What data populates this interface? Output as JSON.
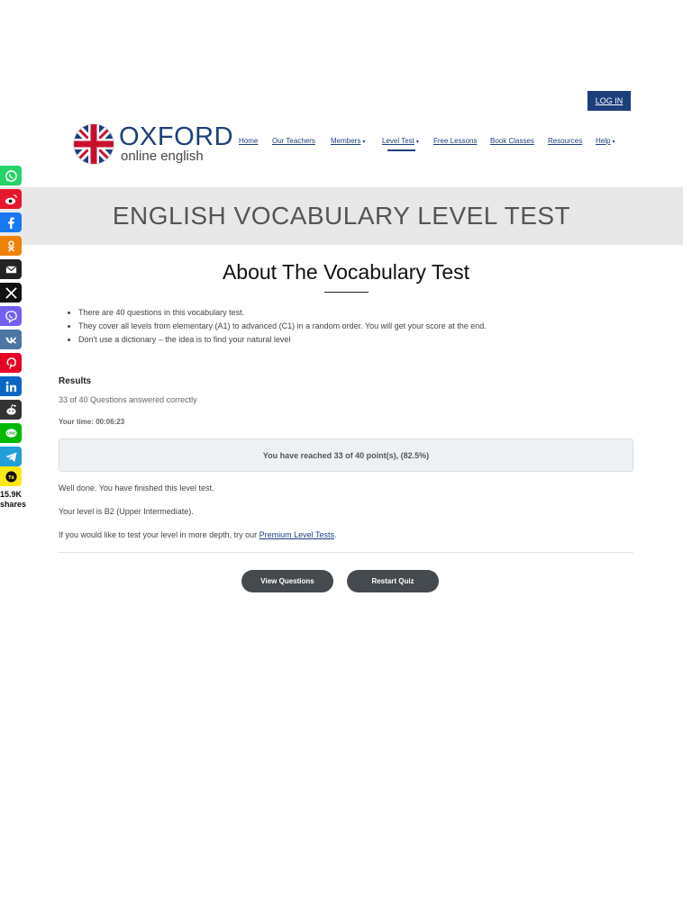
{
  "header": {
    "login_label": "LOG IN",
    "logo": {
      "line1": "OXFORD",
      "line2": "online english"
    },
    "nav": [
      {
        "label": "Home",
        "caret": ""
      },
      {
        "label": "Our Teachers",
        "caret": ""
      },
      {
        "label": "Members",
        "caret": "▾"
      },
      {
        "label": "Level Test",
        "caret": "▾"
      },
      {
        "label": "Free Lessons",
        "caret": ""
      },
      {
        "label": "Book Classes",
        "caret": ""
      },
      {
        "label": "Resources",
        "caret": ""
      },
      {
        "label": "Help",
        "caret": "▾"
      }
    ],
    "active_nav": "Level Test"
  },
  "hero": {
    "title": "ENGLISH VOCABULARY LEVEL TEST"
  },
  "about": {
    "title": "About The Vocabulary Test",
    "bullets": [
      "There are 40 questions in this vocabulary test.",
      "They cover all levels from elementary (A1) to advanced (C1) in a random order. You will get your score at the end.",
      "Don't use a dictionary – the idea is to find your natural level"
    ]
  },
  "results": {
    "label": "Results",
    "count_text": "33 of 40 Questions answered correctly",
    "time_text": "Your time: 00:06:23",
    "score_text": "You have reached 33 of 40 point(s), (82.5%)",
    "done_text": "Well done. You have finished this level test.",
    "level_text": "Your level is B2 (Upper Intermediate).",
    "premium_prefix": "If you would like to test your level in more depth, try our ",
    "premium_link": "Premium Level Tests",
    "premium_suffix": "."
  },
  "actions": {
    "view_questions": "View Questions",
    "restart_quiz": "Restart Quiz"
  },
  "share": {
    "count": "15.9K",
    "label": "shares",
    "buttons": [
      {
        "icon": "whatsapp-icon",
        "color": "#25d366"
      },
      {
        "icon": "weibo-icon",
        "color": "#e6162d"
      },
      {
        "icon": "facebook-icon",
        "color": "#1877f2"
      },
      {
        "icon": "odnoklassniki-icon",
        "color": "#ee8208"
      },
      {
        "icon": "email-icon",
        "color": "#222222"
      },
      {
        "icon": "x-icon",
        "color": "#111111"
      },
      {
        "icon": "viber-icon",
        "color": "#7360f2"
      },
      {
        "icon": "vk-icon",
        "color": "#4c75a3"
      },
      {
        "icon": "pinterest-icon",
        "color": "#e60023"
      },
      {
        "icon": "linkedin-icon",
        "color": "#0a66c2"
      },
      {
        "icon": "reddit-icon",
        "color": "#333333"
      },
      {
        "icon": "line-icon",
        "color": "#00b900"
      },
      {
        "icon": "telegram-icon",
        "color": "#229ed9"
      },
      {
        "icon": "tiktok-icon",
        "color": "#ffe812"
      }
    ]
  },
  "colors": {
    "brand": "#1d3f7c",
    "button": "#454a4f",
    "hero_bg": "#e8e8e8"
  }
}
